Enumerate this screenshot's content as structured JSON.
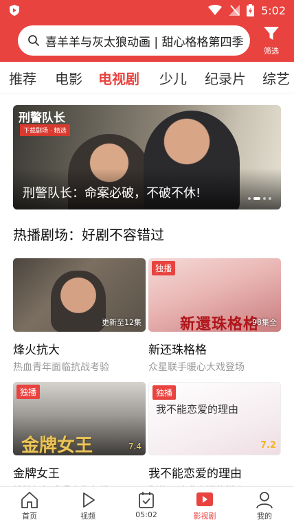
{
  "status_bar": {
    "time": "5:02"
  },
  "header": {
    "search_text": "喜羊羊与灰太狼动画 | 甜心格格第四季",
    "filter_label": "筛选"
  },
  "tabs": [
    {
      "label": "推荐"
    },
    {
      "label": "电影"
    },
    {
      "label": "电视剧",
      "active": true
    },
    {
      "label": "少儿"
    },
    {
      "label": "纪录片"
    },
    {
      "label": "综艺"
    }
  ],
  "banner": {
    "logo_text": "刑警队长",
    "tag_text": "下载剧场 · 精选",
    "title": "刑警队长：命案必破，不破不休!",
    "page_count": 4,
    "active_page": 1
  },
  "section": {
    "title": "热播剧场：好剧不容错过"
  },
  "cards": [
    {
      "name": "烽火抗大",
      "desc": "热血青年面临抗战考验",
      "badge": "",
      "episode": "更新至12集",
      "overlay": ""
    },
    {
      "name": "新还珠格格",
      "desc": "众星联手暖心大戏登场",
      "badge": "独播",
      "episode": "98集全",
      "overlay": "新還珠格格"
    },
    {
      "name": "金牌女王",
      "desc": "铁腕奶奶遭遇人生危机",
      "badge": "独播",
      "episode": "7.4",
      "overlay": "金牌女王"
    },
    {
      "name": "我不能恋爱的理由",
      "desc": "别停下追求幸福的脚步",
      "badge": "独播",
      "episode": "7.2",
      "overlay": "我不能恋爱的理由"
    }
  ],
  "bottom_nav": [
    {
      "label": "首页",
      "icon": "home-icon"
    },
    {
      "label": "视频",
      "icon": "play-icon"
    },
    {
      "label": "05:02",
      "icon": "calendar-check-icon"
    },
    {
      "label": "影视剧",
      "icon": "tv-play-icon",
      "active": true
    },
    {
      "label": "我的",
      "icon": "user-icon"
    }
  ],
  "colors": {
    "brand": "#e8433f",
    "muted_text": "#9a9a9a"
  }
}
